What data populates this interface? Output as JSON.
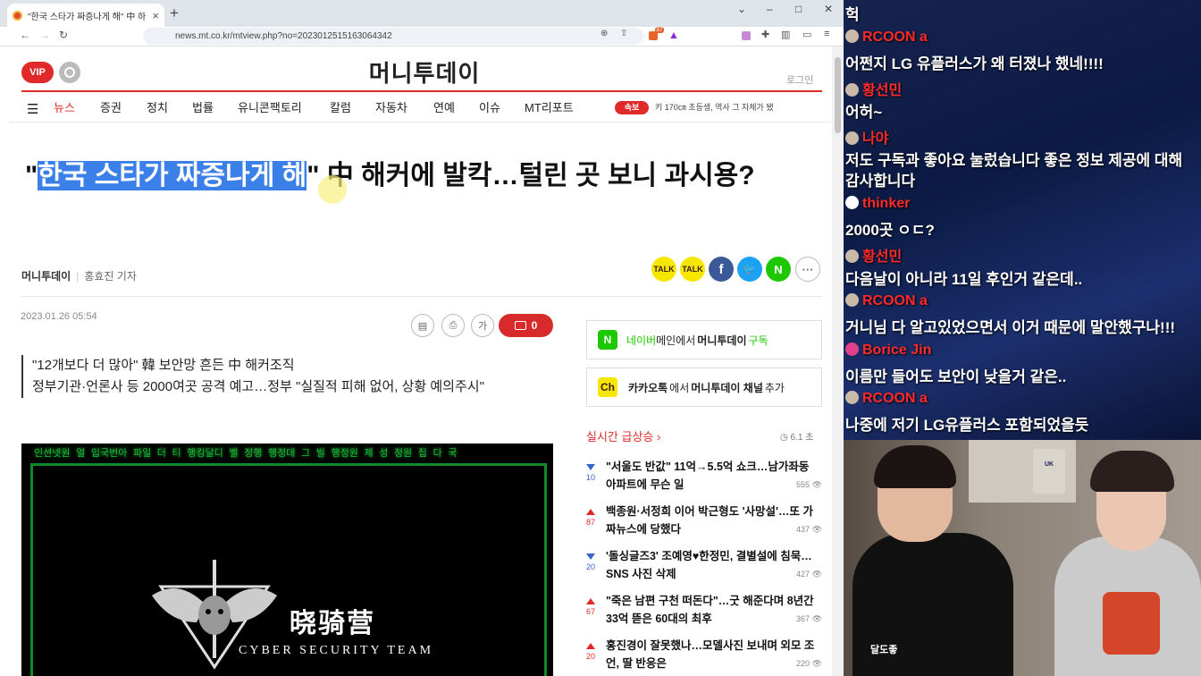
{
  "browser": {
    "tab_title": "\"한국 스타가 짜증나게 해\" 中 하",
    "url": "news.mt.co.kr/mtview.php?no=2023012515163064342",
    "ext_badge": "37"
  },
  "site": {
    "vip_label": "VIP",
    "logo": "머니투데이",
    "login": "로그인",
    "menu": [
      "뉴스",
      "증권",
      "정치",
      "법률",
      "유니콘팩토리",
      "칼럼",
      "자동차",
      "연예",
      "이슈",
      "MT리포트"
    ],
    "breaking_label": "속보",
    "breaking_text": "키 170㎝ 초등생, 역사 그 자체가 됐"
  },
  "article": {
    "title_highlight": "한국 스타가 짜증나게 해",
    "title_rest": "\" 中 해커에 발칵…털린 곳 보니 과시용?",
    "source": "머니투데이",
    "reporter": "홍효진 기자",
    "date": "2023.01.26 05:54",
    "comment_count": "0",
    "font_btn": "가",
    "subtitle_1": "\"12개보다 더 많아\" 韓 보안망 흔든 中 해커조직",
    "subtitle_2": "정부기관·언론사 등 2000여곳 공격 예고…정부 \"실질적 피해 없어, 상황 예의주시\"",
    "photo_top_text": "인션넷원 얼 입국번아 파일 더 티 행킹달디 벨 정행 행정데 그 빌 행정원 제 성 정원 집 다 국",
    "photo_brand": "晓骑营",
    "photo_team": "CYBER SECURITY TEAM"
  },
  "sidebar": {
    "naver_pre": "네이버",
    "naver_mid": " 메인에서 ",
    "naver_brand": "머니투데이",
    "naver_post": " 구독",
    "kakao_pre": "카카오톡",
    "kakao_mid": "에서 ",
    "kakao_brand": "머니투데이 채널",
    "kakao_post": " 추가",
    "realtime_title": "실시간 급상승",
    "realtime_time": "6.1 초",
    "items": [
      {
        "text": "\"서울도 반값\" 11억→5.5억 쇼크…남가좌동 아파트에 무슨 일",
        "rank_change": "10",
        "dir": "down",
        "views": "555"
      },
      {
        "text": "백종원·서정희 이어 박근형도 '사망설'…또 가짜뉴스에 당했다",
        "rank_change": "87",
        "dir": "up",
        "views": "437"
      },
      {
        "text": "'돌싱글즈3' 조예영♥한정민, 결별설에 침묵…SNS 사진 삭제",
        "rank_change": "20",
        "dir": "down",
        "views": "427"
      },
      {
        "text": "\"죽은 남편 구천 떠돈다\"…굿 해준다며 8년간 33억 뜯은 60대의 최후",
        "rank_change": "67",
        "dir": "up",
        "views": "367"
      },
      {
        "text": "홍진경이 잘못했나…모델사진 보내며 외모 조언, 딸 반응은",
        "rank_change": "20",
        "dir": "up",
        "views": "220"
      }
    ]
  },
  "chat": {
    "lines": [
      {
        "type": "msg",
        "text": "헉"
      },
      {
        "type": "name",
        "text": "RCOON a"
      },
      {
        "type": "msg",
        "text": "어쩐지 LG 유플러스가 왜 터졌나 했네!!!!"
      },
      {
        "type": "name",
        "text": "황선민"
      },
      {
        "type": "msg",
        "text": "어허~"
      },
      {
        "type": "name",
        "text": "나야"
      },
      {
        "type": "msg",
        "text": "저도 구독과 좋아요 눌렀습니다 좋은 정보 제공에 대해"
      },
      {
        "type": "msg",
        "text": "감사합니다"
      },
      {
        "type": "name",
        "text": "thinker"
      },
      {
        "type": "msg",
        "text": "2000곳 ㅇㄷ?"
      },
      {
        "type": "name",
        "text": "황선민"
      },
      {
        "type": "msg",
        "text": "다음날이 아니라 11일 후인거 같은데.."
      },
      {
        "type": "name",
        "text": "RCOON a"
      },
      {
        "type": "msg",
        "text": "거니님 다 알고있었으면서 이거 때문에 말안했구나!!!"
      },
      {
        "type": "name",
        "text": "Borice Jin"
      },
      {
        "type": "msg",
        "text": "이름만 들어도 보안이 낮을거 같은.."
      },
      {
        "type": "name",
        "text": "RCOON a"
      },
      {
        "type": "msg",
        "text": "나중에 저기 LG유플러스 포함되었을듯"
      }
    ]
  },
  "cam": {
    "shirt_logo": "달도좋",
    "poster_text": "UK"
  }
}
